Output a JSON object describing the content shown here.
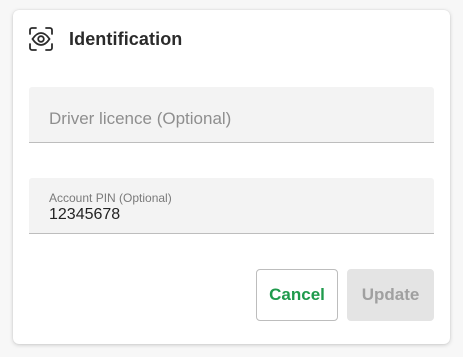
{
  "header": {
    "title": "Identification",
    "icon": "eye-scan-icon"
  },
  "fields": {
    "driver_licence": {
      "placeholder": "Driver licence (Optional)",
      "value": ""
    },
    "account_pin": {
      "label": "Account PIN (Optional)",
      "value": "12345678"
    }
  },
  "actions": {
    "cancel_label": "Cancel",
    "update_label": "Update"
  },
  "colors": {
    "accent": "#1f9a4c",
    "disabled_bg": "#e4e4e4",
    "disabled_text": "#a0a0a0",
    "field_bg": "#f3f3f3"
  }
}
